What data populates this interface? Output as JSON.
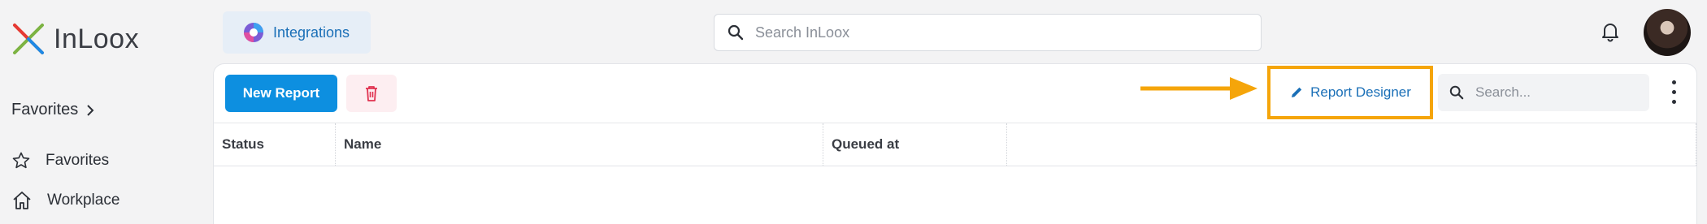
{
  "app": {
    "name": "InLoox"
  },
  "header": {
    "integrations_label": "Integrations",
    "search_placeholder": "Search InLoox"
  },
  "sidebar": {
    "favorites_header": "Favorites",
    "items": [
      {
        "label": "Favorites",
        "icon": "star-icon"
      },
      {
        "label": "Workplace",
        "icon": "home-icon"
      }
    ]
  },
  "toolbar": {
    "new_report_label": "New Report",
    "report_designer_label": "Report Designer",
    "search_placeholder": "Search..."
  },
  "table": {
    "columns": [
      "Status",
      "Name",
      "Queued at"
    ],
    "rows": []
  },
  "colors": {
    "primary": "#0d8fe0",
    "highlight": "#f5a50a",
    "link": "#1a6fb7",
    "delete": "#e0314f"
  }
}
